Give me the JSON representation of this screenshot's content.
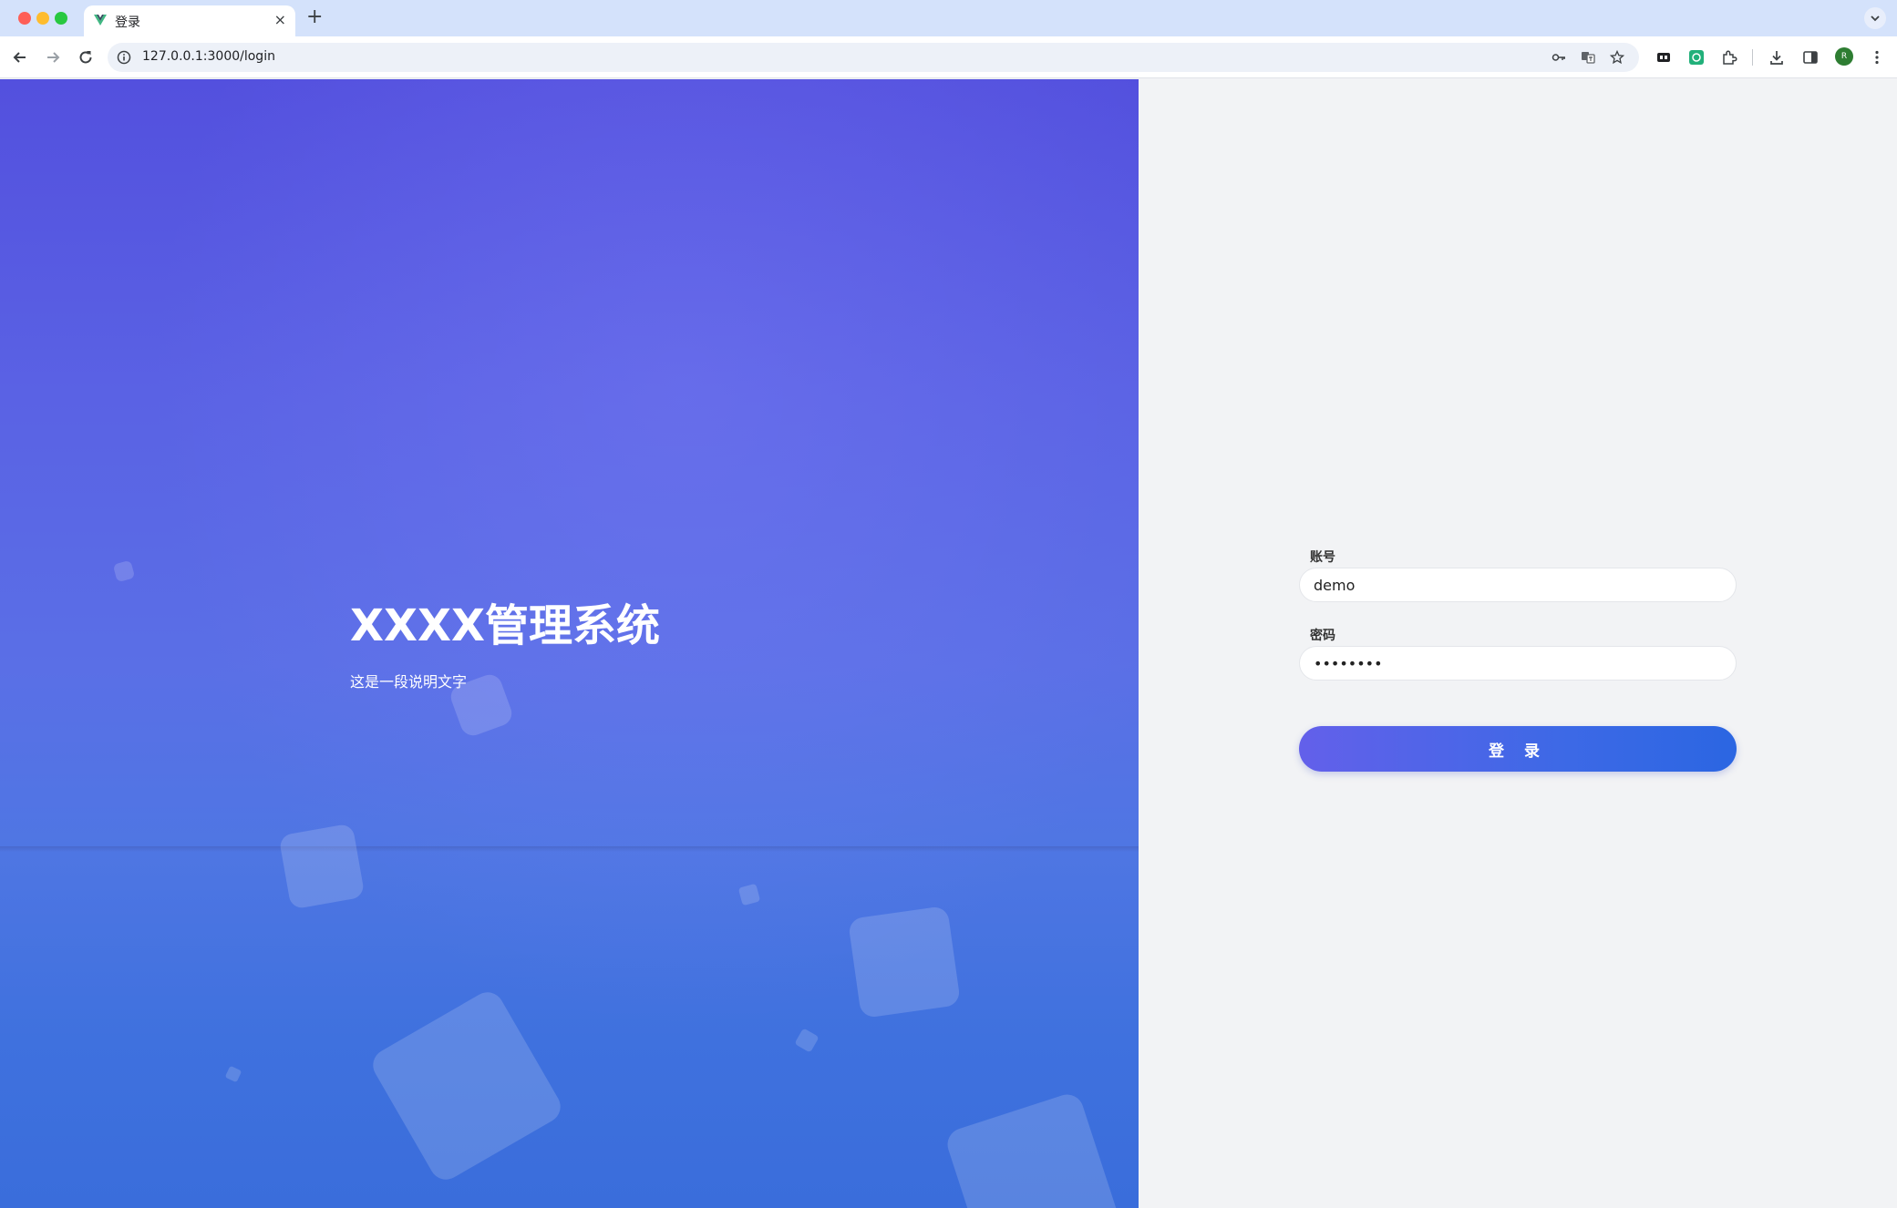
{
  "browser": {
    "tab_title": "登录",
    "tab_close": "×",
    "new_tab": "+",
    "url": "127.0.0.1:3000/login",
    "profile_initial": "R",
    "icons": {
      "favicon": "vue-logo-icon",
      "back": "back-arrow-icon",
      "forward": "forward-arrow-icon",
      "reload": "reload-icon",
      "site_info": "info-icon",
      "password": "key-icon",
      "translate": "translate-icon",
      "bookmark": "star-icon",
      "extensions": "puzzle-icon",
      "download": "download-icon",
      "side_panel": "side-panel-icon",
      "menu": "kebab-menu-icon"
    }
  },
  "hero": {
    "title": "XXXX管理系统",
    "subtitle": "这是一段说明文字"
  },
  "login": {
    "account_label": "账号",
    "account_value": "demo",
    "password_label": "密码",
    "password_value": "12345678",
    "submit_label": "登 录"
  },
  "colors": {
    "hero_top": "#5350de",
    "hero_bottom": "#3a6ddb",
    "button_start": "#6360ea",
    "button_end": "#2b66e2",
    "pane_background": "#f2f3f5"
  }
}
